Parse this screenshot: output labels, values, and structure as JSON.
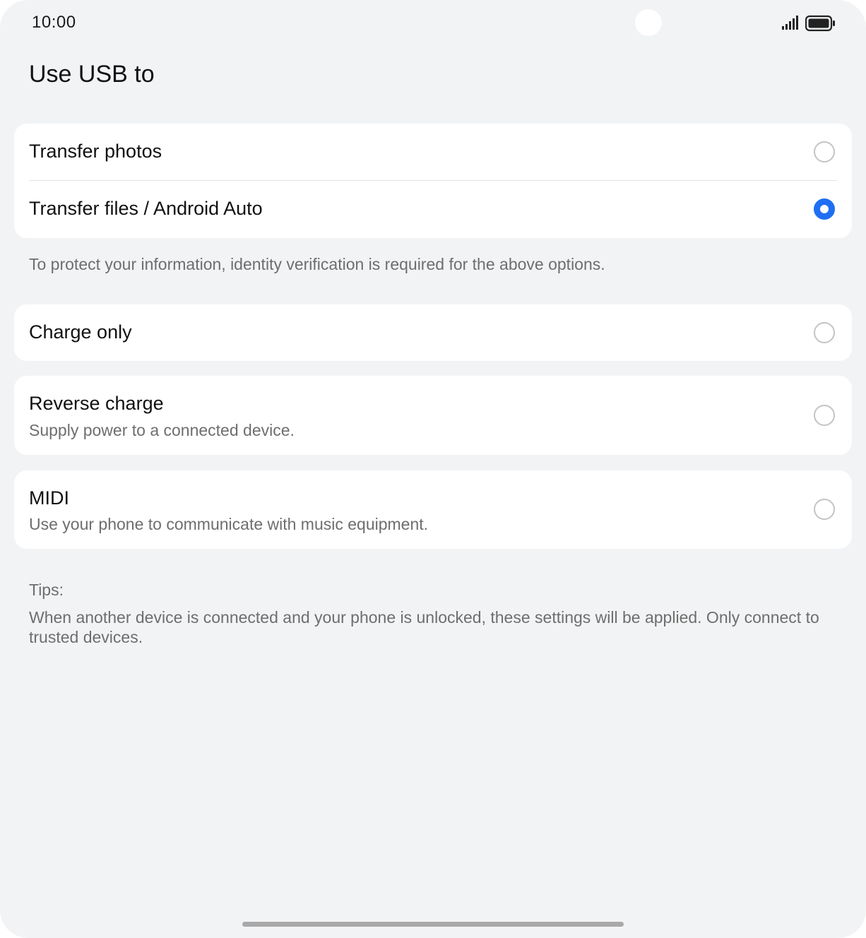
{
  "status_bar": {
    "time": "10:00",
    "signal_icon": "cellular-signal-icon",
    "battery_icon": "battery-icon"
  },
  "page": {
    "title": "Use USB to"
  },
  "options": {
    "transfer_photos": {
      "title": "Transfer photos",
      "selected": false
    },
    "transfer_files": {
      "title": "Transfer files / Android Auto",
      "selected": true
    },
    "identity_note": "To protect your information, identity verification is required for the above options.",
    "charge_only": {
      "title": "Charge only",
      "selected": false
    },
    "reverse_charge": {
      "title": "Reverse charge",
      "subtitle": "Supply power to a connected device.",
      "selected": false
    },
    "midi": {
      "title": "MIDI",
      "subtitle": "Use your phone to communicate with music equipment.",
      "selected": false
    }
  },
  "tips": {
    "label": "Tips:",
    "body": "When another device is connected and your phone is unlocked, these settings will be applied. Only connect to trusted devices."
  },
  "colors": {
    "accent": "#1f6ff3",
    "background": "#f2f3f5",
    "card": "#ffffff"
  }
}
